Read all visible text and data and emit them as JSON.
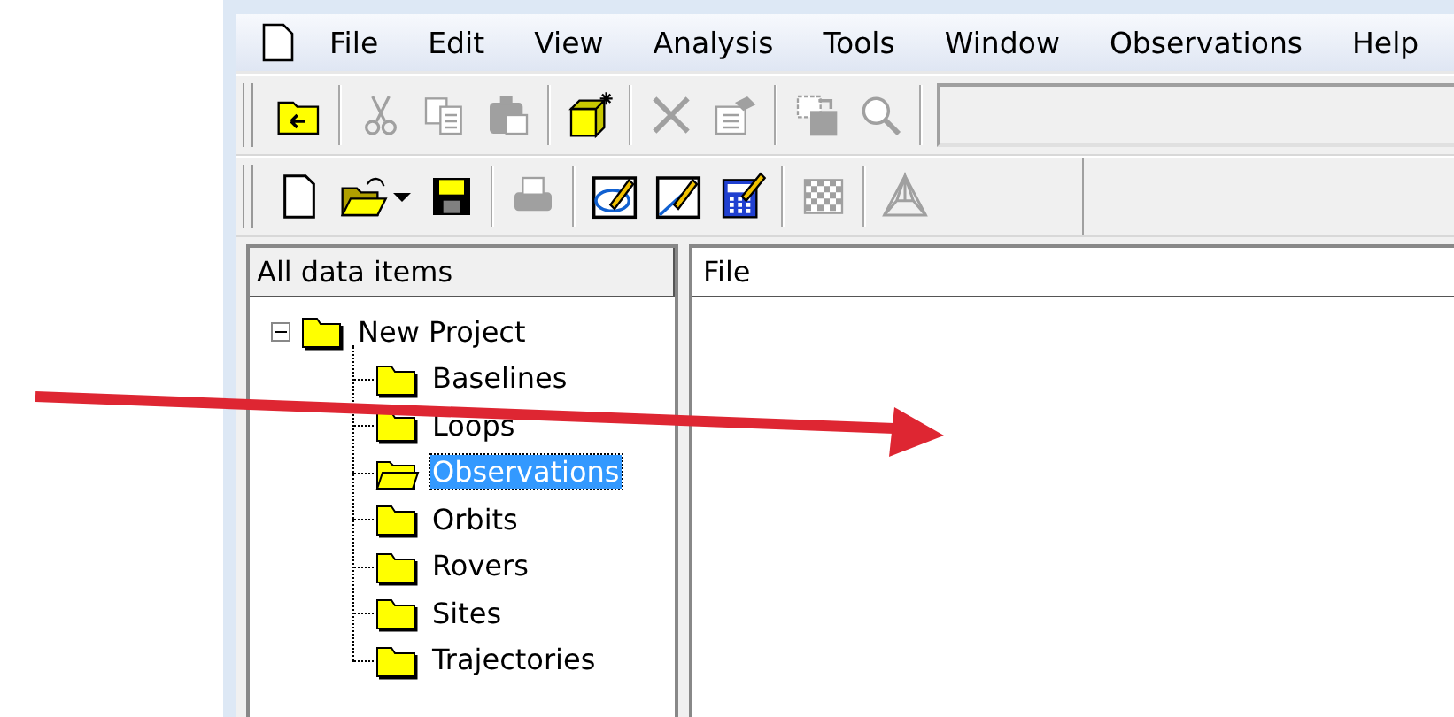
{
  "menu_bar": {
    "items": [
      {
        "kind": "document-icon"
      },
      {
        "label": "File"
      },
      {
        "label": "Edit"
      },
      {
        "label": "View"
      },
      {
        "label": "Analysis"
      },
      {
        "label": "Tools"
      },
      {
        "label": "Window"
      },
      {
        "label": "Observations"
      },
      {
        "label": "Help"
      }
    ]
  },
  "toolbars": [
    {
      "kind": "wide",
      "items": [
        {
          "kind": "folder-up",
          "disabled": false
        },
        {
          "kind": "separator"
        },
        {
          "kind": "cut",
          "disabled": true
        },
        {
          "kind": "copy",
          "disabled": true
        },
        {
          "kind": "paste",
          "disabled": true
        },
        {
          "kind": "separator"
        },
        {
          "kind": "cube",
          "disabled": false
        },
        {
          "kind": "separator"
        },
        {
          "kind": "delete",
          "disabled": true
        },
        {
          "kind": "properties",
          "disabled": true
        },
        {
          "kind": "separator"
        },
        {
          "kind": "import",
          "disabled": true
        },
        {
          "kind": "search",
          "disabled": true
        },
        {
          "kind": "separator"
        },
        {
          "kind": "field"
        }
      ]
    },
    {
      "kind": "short",
      "items": [
        {
          "kind": "new",
          "disabled": false
        },
        {
          "kind": "open",
          "disabled": false
        },
        {
          "kind": "caret",
          "disabled": false
        },
        {
          "kind": "save",
          "disabled": false
        },
        {
          "kind": "separator"
        },
        {
          "kind": "print",
          "disabled": true
        },
        {
          "kind": "separator"
        },
        {
          "kind": "ellipse-pencil",
          "disabled": false
        },
        {
          "kind": "line-pencil",
          "disabled": false
        },
        {
          "kind": "calculator",
          "disabled": false
        },
        {
          "kind": "separator"
        },
        {
          "kind": "checker",
          "disabled": true
        },
        {
          "kind": "separator"
        },
        {
          "kind": "network",
          "disabled": true
        }
      ]
    }
  ],
  "tree_panel": {
    "header": "All data items",
    "items": [
      {
        "label": "New Project",
        "expanded": true,
        "selected": false,
        "children": [
          {
            "label": "Baselines",
            "selected": false
          },
          {
            "label": "Loops",
            "selected": false
          },
          {
            "label": "Observations",
            "selected": true
          },
          {
            "label": "Orbits",
            "selected": false
          },
          {
            "label": "Rovers",
            "selected": false
          },
          {
            "label": "Sites",
            "selected": false
          },
          {
            "label": "Trajectories",
            "selected": false
          }
        ]
      }
    ]
  },
  "file_panel": {
    "header": "File"
  },
  "annotations": [
    {
      "kind": "arrow"
    }
  ]
}
